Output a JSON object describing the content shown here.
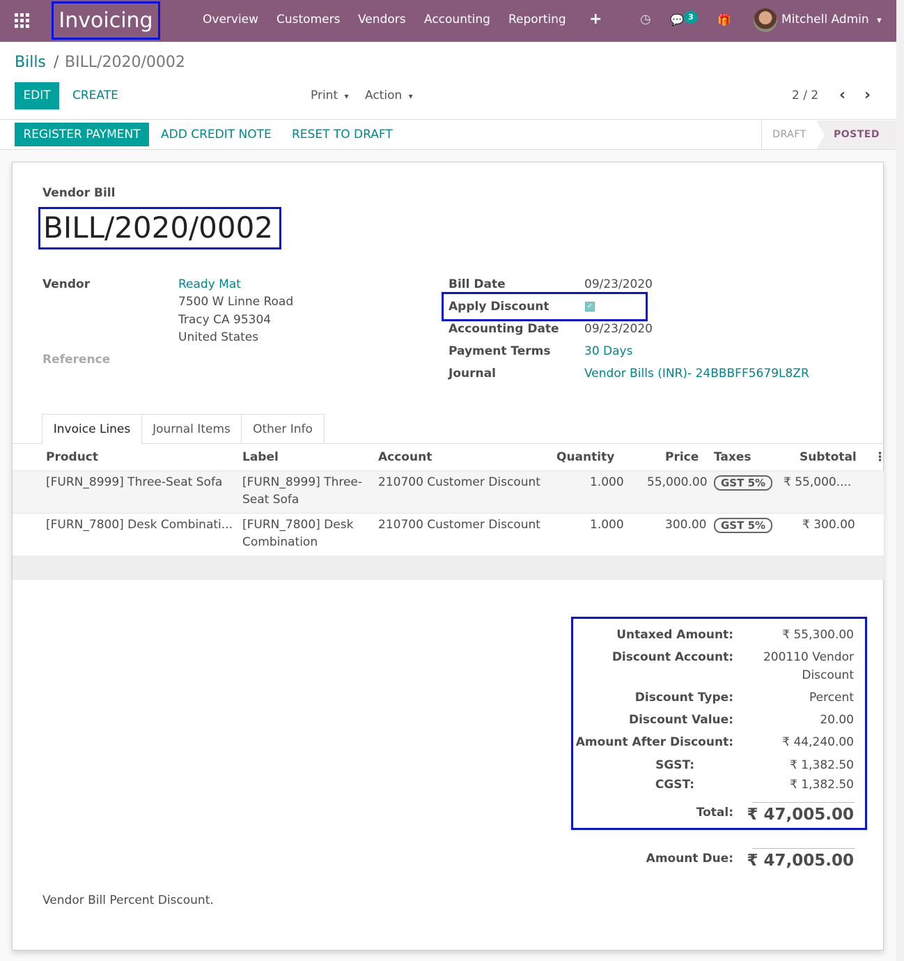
{
  "navbar": {
    "brand": "Invoicing",
    "menu": [
      "Overview",
      "Customers",
      "Vendors",
      "Accounting",
      "Reporting"
    ],
    "plus": "+",
    "clock_icon": "◷",
    "chat_icon": "💬",
    "chat_badge": "3",
    "gift_icon": "🎁",
    "user": "Mitchell Admin",
    "caret": "▾"
  },
  "breadcrumb": {
    "parent": "Bills",
    "sep": "/",
    "current": "BILL/2020/0002"
  },
  "toolbar": {
    "edit": "EDIT",
    "create": "CREATE",
    "print": "Print",
    "action": "Action",
    "caret": "▾",
    "pager": "2 / 2",
    "prev": "‹",
    "next": "›"
  },
  "statusbar": {
    "register_payment": "REGISTER PAYMENT",
    "add_credit_note": "ADD CREDIT NOTE",
    "reset_to_draft": "RESET TO DRAFT",
    "stages": [
      "DRAFT",
      "POSTED"
    ]
  },
  "form": {
    "type_label": "Vendor Bill",
    "name": "BILL/2020/0002",
    "vendor_label": "Vendor",
    "vendor_name": "Ready Mat",
    "vendor_address": [
      "7500 W Linne Road",
      "Tracy CA 95304",
      "United States"
    ],
    "reference_label": "Reference",
    "bill_date_label": "Bill Date",
    "bill_date": "09/23/2020",
    "apply_discount_label": "Apply Discount",
    "apply_discount_check": "✓",
    "accounting_date_label": "Accounting Date",
    "accounting_date": "09/23/2020",
    "payment_terms_label": "Payment Terms",
    "payment_terms": "30 Days",
    "journal_label": "Journal",
    "journal": "Vendor Bills (INR)- 24BBBFF5679L8ZR"
  },
  "tabs": [
    "Invoice Lines",
    "Journal Items",
    "Other Info"
  ],
  "lines": {
    "headers": [
      "Product",
      "Label",
      "Account",
      "Quantity",
      "Price",
      "Taxes",
      "Subtotal"
    ],
    "options_icon": "⋮",
    "rows": [
      {
        "product": "[FURN_8999] Three-Seat Sofa",
        "label1": "[FURN_8999] Three-",
        "label2": "Seat Sofa",
        "account": "210700 Customer Discount",
        "quantity": "1.000",
        "price": "55,000.00",
        "tax": "GST 5%",
        "subtotal": "₹ 55,000...."
      },
      {
        "product": "[FURN_7800] Desk Combinati...",
        "label1": "[FURN_7800] Desk",
        "label2": "Combination",
        "account": "210700 Customer Discount",
        "quantity": "1.000",
        "price": "300.00",
        "tax": "GST 5%",
        "subtotal": "₹ 300.00"
      }
    ]
  },
  "totals": {
    "untaxed_label": "Untaxed Amount:",
    "untaxed": "₹ 55,300.00",
    "discount_account_label": "Discount Account:",
    "discount_account1": "200110 Vendor",
    "discount_account2": "Discount",
    "discount_type_label": "Discount Type:",
    "discount_type": "Percent",
    "discount_value_label": "Discount Value:",
    "discount_value": "20.00",
    "after_discount_label": "Amount After Discount:",
    "after_discount": "₹ 44,240.00",
    "sgst_label": "SGST:",
    "sgst": "₹ 1,382.50",
    "cgst_label": "CGST:",
    "cgst": "₹ 1,382.50",
    "total_label": "Total:",
    "total": "₹ 47,005.00",
    "amount_due_label": "Amount Due:",
    "amount_due": "₹ 47,005.00"
  },
  "narration": "Vendor Bill Percent Discount."
}
